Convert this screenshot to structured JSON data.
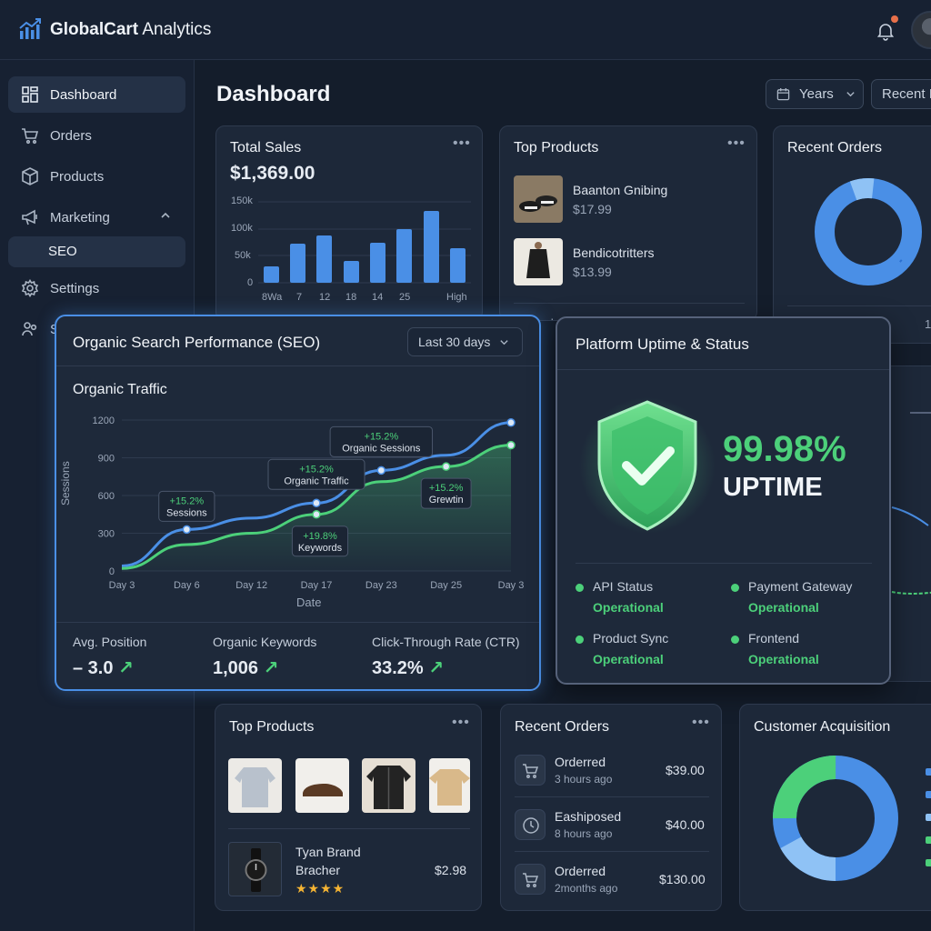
{
  "app": {
    "title_bold": "GlobalCart",
    "title_rest": " Analytics"
  },
  "sidebar": {
    "items": [
      {
        "label": "Dashboard",
        "icon": "grid-icon"
      },
      {
        "label": "Orders",
        "icon": "cart-icon"
      },
      {
        "label": "Products",
        "icon": "box-icon"
      },
      {
        "label": "Marketing",
        "icon": "megaphone-icon"
      },
      {
        "label": "SEO"
      },
      {
        "label": "Settings",
        "icon": "gear-icon"
      },
      {
        "label": "S",
        "icon": "users-icon"
      }
    ]
  },
  "header": {
    "page_title": "Dashboard",
    "years_label": "Years",
    "recent_label": "Recent I"
  },
  "total_sales": {
    "title": "Total Sales",
    "amount": "$1,369.00",
    "y_ticks": [
      "150k",
      "100k",
      "50k",
      "0"
    ],
    "x_labels": [
      "8Wa",
      "7",
      "12",
      "18",
      "14",
      "25",
      "High"
    ]
  },
  "top_products_top": {
    "title": "Top Products",
    "items": [
      {
        "name": "Baanton Gnibing",
        "price": "$17.99"
      },
      {
        "name": "Bendicotritters",
        "price": "$13.99"
      }
    ],
    "footer_fragment": "ord"
  },
  "recent_orders_top": {
    "title": "Recent Orders",
    "footer_fragment": "1"
  },
  "seo": {
    "title": "Organic Search Performance (SEO)",
    "range": "Last 30 days",
    "chart_title": "Organic Traffic",
    "metrics": [
      {
        "label": "Avg. Position",
        "value": "– 3.0"
      },
      {
        "label": "Organic Keywords",
        "value": "1,006"
      },
      {
        "label": "Click-Through Rate (CTR)",
        "value": "33.2%"
      }
    ]
  },
  "chart_data": {
    "type": "line",
    "title": "Organic Traffic",
    "xlabel": "Date",
    "ylabel": "Sessions",
    "x": [
      "Day 3",
      "Day 6",
      "Day 12",
      "Day 17",
      "Day 23",
      "Day 25",
      "Day 3"
    ],
    "ylim": [
      0,
      1200
    ],
    "y_ticks": [
      0,
      300,
      600,
      900,
      1200
    ],
    "series": [
      {
        "values": [
          40,
          330,
          420,
          540,
          800,
          920,
          1180
        ],
        "color": "#4a8fe6"
      },
      {
        "values": [
          20,
          210,
          300,
          450,
          710,
          830,
          1000
        ],
        "color": "#4cd07a"
      }
    ],
    "annotations": [
      {
        "pct": "+15.2%",
        "label": "Sessions"
      },
      {
        "pct": "+15.2%",
        "label": "Organic Traffic"
      },
      {
        "pct": "+15.2%",
        "label": "Organic Sessions"
      },
      {
        "pct": "+19.8%",
        "label": "Keywords"
      },
      {
        "pct": "+15.2%",
        "label": "Grewtin"
      }
    ]
  },
  "uptime": {
    "title": "Platform Uptime & Status",
    "percent": "99.98%",
    "label": "UPTIME",
    "statuses": [
      {
        "name": "API Status",
        "state": "Operational"
      },
      {
        "name": "Payment Gateway",
        "state": "Operational"
      },
      {
        "name": "Product Sync",
        "state": "Operational"
      },
      {
        "name": "Frontend",
        "state": "Operational"
      }
    ]
  },
  "top_products_bottom": {
    "title": "Top Products",
    "featured": {
      "name_line1": "Tyan Brand",
      "name_line2": "Bracher",
      "price": "$2.98",
      "rating": "★★★★"
    }
  },
  "recent_orders_bottom": {
    "title": "Recent Orders",
    "orders": [
      {
        "name": "Orderred",
        "time": "3 hours ago",
        "amount": "$39.00"
      },
      {
        "name": "Eashiposed",
        "time": "8 hours ago",
        "amount": "$40.00"
      },
      {
        "name": "Orderred",
        "time": "2months ago",
        "amount": "$130.00"
      }
    ]
  },
  "customer_acquisition": {
    "title": "Customer Acquisition"
  },
  "colors": {
    "accent_blue": "#4a8fe6",
    "accent_green": "#4cd07a",
    "bg": "#141d2b"
  }
}
